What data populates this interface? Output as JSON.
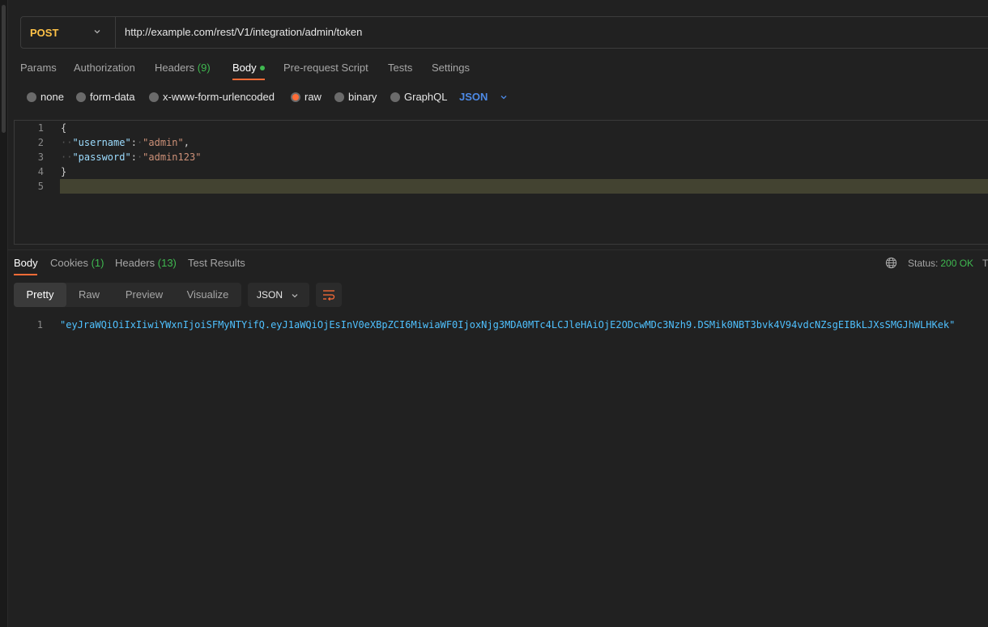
{
  "request": {
    "method": "POST",
    "url": "http://example.com/rest/V1/integration/admin/token"
  },
  "request_tabs": [
    {
      "label": "Params"
    },
    {
      "label": "Authorization"
    },
    {
      "label": "Headers",
      "count": "(9)"
    },
    {
      "label": "Body"
    },
    {
      "label": "Pre-request Script"
    },
    {
      "label": "Tests"
    },
    {
      "label": "Settings"
    }
  ],
  "body_types": [
    "none",
    "form-data",
    "x-www-form-urlencoded",
    "raw",
    "binary",
    "GraphQL"
  ],
  "selected_body_type": "raw",
  "raw_language": "JSON",
  "editor": {
    "line_numbers": [
      "1",
      "2",
      "3",
      "4",
      "5"
    ],
    "open_brace": "{",
    "close_brace": "}",
    "username_key": "\"username\"",
    "username_value": "\"admin\"",
    "password_key": "\"password\"",
    "password_value": "\"admin123\"",
    "colon": ":",
    "comma": ","
  },
  "response_tabs": [
    {
      "label": "Body"
    },
    {
      "label": "Cookies",
      "count": "(1)"
    },
    {
      "label": "Headers",
      "count": "(13)"
    },
    {
      "label": "Test Results"
    }
  ],
  "status": {
    "label": "Status:",
    "value": "200 OK",
    "truncated_next": "T"
  },
  "view_modes": [
    "Pretty",
    "Raw",
    "Preview",
    "Visualize"
  ],
  "active_view_mode": "Pretty",
  "response_format": "JSON",
  "response_body": {
    "line_number": "1",
    "text": "\"eyJraWQiOiIxIiwiYWxnIjoiSFMyNTYifQ.eyJ1aWQiOjEsInV0eXBpZCI6MiwiaWF0IjoxNjg3MDA0MTc4LCJleHAiOjE2ODcwMDc3Nzh9.DSMik0NBT3bvk4V94vdcNZsgEIBkLJXsSMGJhWLHKek\""
  },
  "colors": {
    "accent": "#ff6c37",
    "method": "#ffc247",
    "success": "#3fb950",
    "link": "#4d8ae6"
  },
  "icons": [
    "chevron-down-icon",
    "globe-icon",
    "wrap-lines-icon"
  ]
}
